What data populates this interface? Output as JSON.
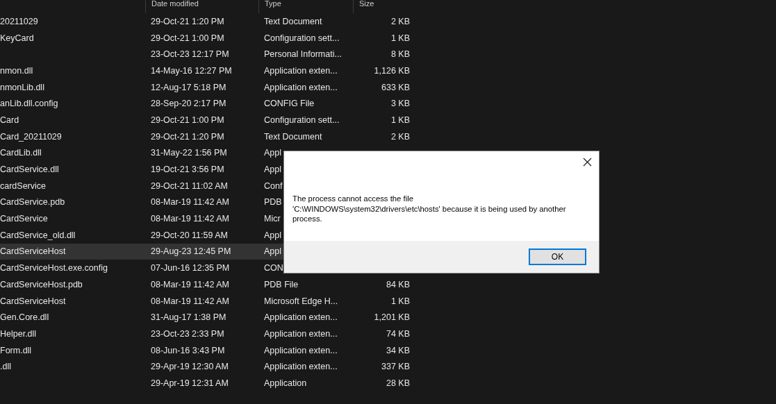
{
  "file_list": {
    "columns": [
      "Date modified",
      "Type",
      "Size"
    ],
    "rows": [
      {
        "name": "20211029",
        "date": "29-Oct-21 1:20 PM",
        "type": "Text Document",
        "size": "2 KB",
        "selected": false
      },
      {
        "name": "KeyCard",
        "date": "29-Oct-21 1:00 PM",
        "type": "Configuration sett...",
        "size": "1 KB",
        "selected": false
      },
      {
        "date": "23-Oct-23 12:17 PM",
        "type": "Personal Informati...",
        "size": "8 KB",
        "selected": false
      },
      {
        "name": "nmon.dll",
        "date": "14-May-16 12:27 PM",
        "type": "Application exten...",
        "size": "1,126 KB",
        "selected": false
      },
      {
        "name": "nmonLib.dll",
        "date": "12-Aug-17 5:18 PM",
        "type": "Application exten...",
        "size": "633 KB",
        "selected": false
      },
      {
        "name": "anLib.dll.config",
        "date": "28-Sep-20 2:17 PM",
        "type": "CONFIG File",
        "size": "3 KB",
        "selected": false
      },
      {
        "name": "Card",
        "date": "29-Oct-21 1:00 PM",
        "type": "Configuration sett...",
        "size": "1 KB",
        "selected": false
      },
      {
        "name": "Card_20211029",
        "date": "29-Oct-21 1:20 PM",
        "type": "Text Document",
        "size": "2 KB",
        "selected": false
      },
      {
        "name": "CardLib.dll",
        "date": "31-May-22 1:56 PM",
        "type": "Appl",
        "selected": false
      },
      {
        "name": "CardService.dll",
        "date": "19-Oct-21 3:56 PM",
        "type": "Appl",
        "selected": false
      },
      {
        "name": "cardService",
        "date": "29-Oct-21 11:02 AM",
        "type": "Conf",
        "selected": false
      },
      {
        "name": "CardService.pdb",
        "date": "08-Mar-19 11:42 AM",
        "type": "PDB",
        "selected": false
      },
      {
        "name": "CardService",
        "date": "08-Mar-19 11:42 AM",
        "type": "Micr",
        "selected": false
      },
      {
        "name": "CardService_old.dll",
        "date": "29-Oct-20 11:59 AM",
        "type": "Appl",
        "selected": false
      },
      {
        "name": "CardServiceHost",
        "date": "29-Aug-23 12:45 PM",
        "type": "Appl",
        "selected": true
      },
      {
        "name": "CardServiceHost.exe.config",
        "date": "07-Jun-16 12:35 PM",
        "type": "CON",
        "selected": false
      },
      {
        "name": "CardServiceHost.pdb",
        "date": "08-Mar-19 11:42 AM",
        "type": "PDB File",
        "size": "84 KB",
        "selected": false
      },
      {
        "name": "CardServiceHost",
        "date": "08-Mar-19 11:42 AM",
        "type": "Microsoft Edge H...",
        "size": "1 KB",
        "selected": false
      },
      {
        "name": "Gen.Core.dll",
        "date": "31-Aug-17 1:38 PM",
        "type": "Application exten...",
        "size": "1,201 KB",
        "selected": false
      },
      {
        "name": "Helper.dll",
        "date": "23-Oct-23 2:33 PM",
        "type": "Application exten...",
        "size": "74 KB",
        "selected": false
      },
      {
        "name": "Form.dll",
        "date": "08-Jun-16 3:43 PM",
        "type": "Application exten...",
        "size": "34 KB",
        "selected": false
      },
      {
        "name": ".dll",
        "date": "29-Apr-19 12:30 AM",
        "type": "Application exten...",
        "size": "337 KB",
        "selected": false
      },
      {
        "date": "29-Apr-19 12:31 AM",
        "type": "Application",
        "size": "28 KB",
        "selected": false
      }
    ]
  },
  "dialog": {
    "message": "The process cannot access the file\n'C:\\WINDOWS\\system32\\drivers\\etc\\hosts' because it is being used by another process.",
    "button": "OK"
  }
}
